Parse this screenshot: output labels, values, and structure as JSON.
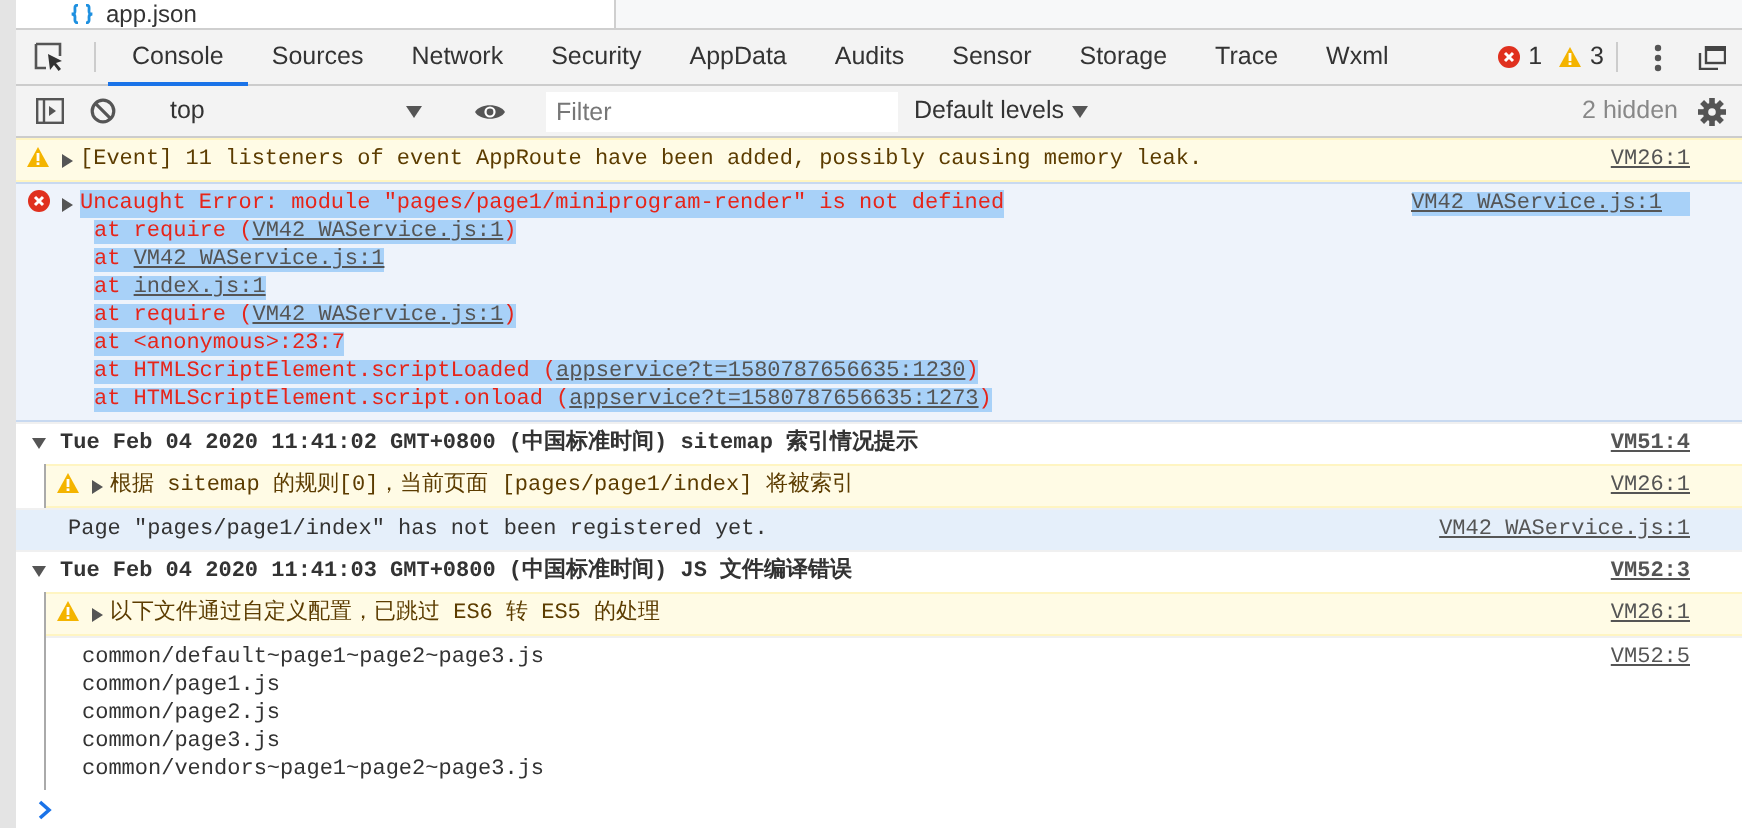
{
  "file_tree": {
    "item": "app.json"
  },
  "tabs": [
    {
      "label": "Console",
      "selected": true
    },
    {
      "label": "Sources",
      "selected": false
    },
    {
      "label": "Network",
      "selected": false
    },
    {
      "label": "Security",
      "selected": false
    },
    {
      "label": "AppData",
      "selected": false
    },
    {
      "label": "Audits",
      "selected": false
    },
    {
      "label": "Sensor",
      "selected": false
    },
    {
      "label": "Storage",
      "selected": false
    },
    {
      "label": "Trace",
      "selected": false
    },
    {
      "label": "Wxml",
      "selected": false
    }
  ],
  "counters": {
    "errors": "1",
    "warnings": "3"
  },
  "toolbar": {
    "context": "top",
    "filter_placeholder": "Filter",
    "levels": "Default levels",
    "hidden": "2 hidden"
  },
  "messages": [
    {
      "kind": "warning",
      "expanded": false,
      "text_selected": false,
      "text": "[Event] 11 listeners of event AppRoute have been added, possibly causing memory leak.",
      "source": "VM26:1"
    },
    {
      "kind": "error",
      "expanded": false,
      "text_selected": true,
      "text": "Uncaught Error: module \"pages/page1/miniprogram-render\" is not defined",
      "source": "VM42 WAService.js:1",
      "stack": [
        {
          "before": "at require (",
          "link": "VM42 WAService.js:1",
          "after": ")"
        },
        {
          "before": "at ",
          "link": "VM42 WAService.js:1"
        },
        {
          "before": "at ",
          "link": "index.js:1"
        },
        {
          "before": "at require (",
          "link": "VM42 WAService.js:1",
          "after": ")"
        },
        {
          "before": "at <anonymous>:23:7"
        },
        {
          "before": "at HTMLScriptElement.scriptLoaded (",
          "link": "appservice?t=1580787656635:1230",
          "after": ")"
        },
        {
          "before": "at HTMLScriptElement.script.onload (",
          "link": "appservice?t=1580787656635:1273",
          "after": ")"
        }
      ]
    },
    {
      "kind": "group",
      "expanded": true,
      "text": "Tue Feb 04 2020 11:41:02 GMT+0800 (中国标准时间) sitemap 索引情况提示",
      "source": "VM51:4",
      "children": [
        {
          "kind": "warning",
          "expanded": false,
          "text_selected": false,
          "text": "根据 sitemap 的规则[0]，当前页面 [pages/page1/index] 将被索引",
          "source": "VM26:1"
        }
      ]
    },
    {
      "kind": "verbose",
      "text": "Page \"pages/page1/index\" has not been registered yet.",
      "source": "VM42 WAService.js:1"
    },
    {
      "kind": "group",
      "expanded": true,
      "text": "Tue Feb 04 2020 11:41:03 GMT+0800 (中国标准时间) JS 文件编译错误",
      "source": "VM52:3",
      "children": [
        {
          "kind": "warning",
          "expanded": false,
          "text_selected": false,
          "text": "以下文件通过自定义配置，已跳过 ES6 转 ES5 的处理",
          "source": "VM26:1"
        },
        {
          "kind": "log",
          "source": "VM52:5",
          "lines": [
            "common/default~page1~page2~page3.js",
            "common/page1.js",
            "common/page2.js",
            "common/page3.js",
            "common/vendors~page1~page2~page3.js"
          ]
        }
      ]
    }
  ]
}
